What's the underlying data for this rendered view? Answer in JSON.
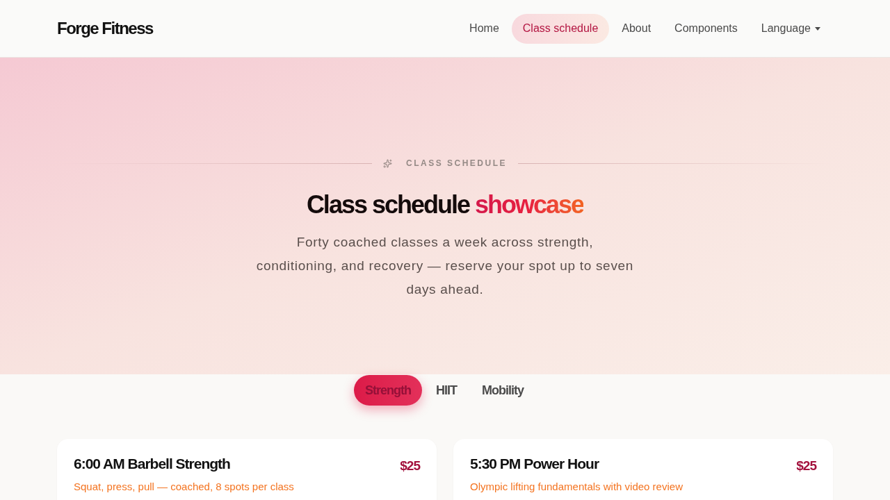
{
  "brand": "Forge Fitness",
  "nav": [
    {
      "kind": "link",
      "label": "Home",
      "selected": false
    },
    {
      "kind": "link",
      "label": "Class schedule",
      "selected": true
    },
    {
      "kind": "link",
      "label": "About",
      "selected": false
    },
    {
      "kind": "link",
      "label": "Components",
      "selected": false
    },
    {
      "kind": "dropdown",
      "label": "Language",
      "selected": false
    }
  ],
  "hero": {
    "eyebrow": "CLASS SCHEDULE",
    "title": "Class schedule",
    "title_highlight": "showcase",
    "description": "Forty coached classes a week across strength, conditioning, and recovery — reserve your spot up to seven days ahead."
  },
  "tabs": [
    {
      "label": "Strength",
      "selected": true
    },
    {
      "label": "HIIT",
      "selected": false
    },
    {
      "label": "Mobility",
      "selected": false
    }
  ],
  "classes": [
    {
      "title": "6:00 AM Barbell Strength",
      "description": "Squat, press, pull — coached, 8 spots per class",
      "price": "$25"
    },
    {
      "title": "5:30 PM Power Hour",
      "description": "Olympic lifting fundamentals with video review",
      "price": "$25"
    }
  ]
}
